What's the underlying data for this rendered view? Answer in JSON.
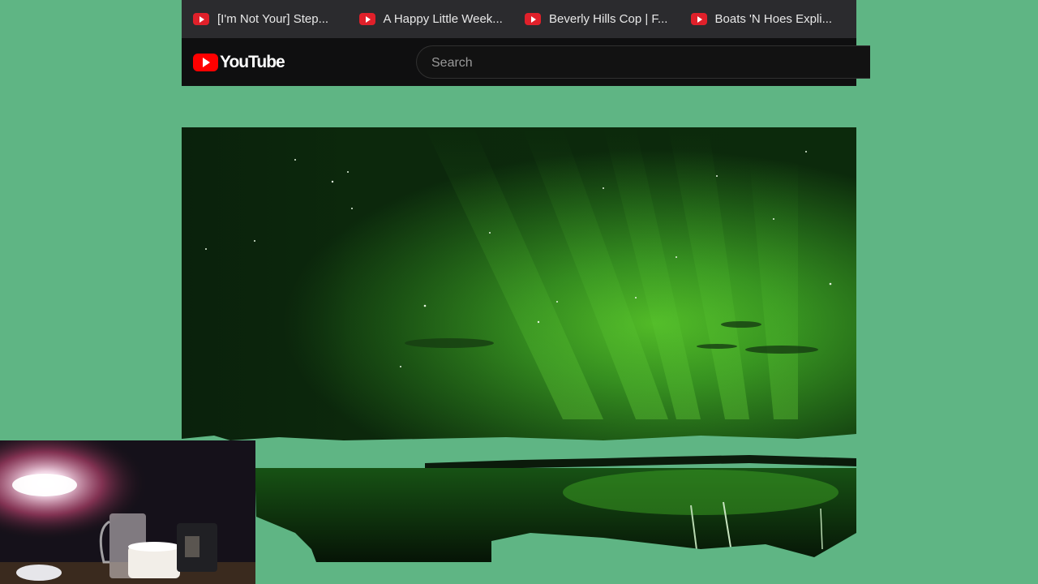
{
  "bookmarks": [
    {
      "label": "[I'm Not Your] Step...",
      "icon": "youtube-favicon-icon"
    },
    {
      "label": "A Happy Little Week...",
      "icon": "youtube-favicon-icon"
    },
    {
      "label": "Beverly Hills Cop | F...",
      "icon": "youtube-favicon-icon"
    },
    {
      "label": "Boats 'N Hoes Expli...",
      "icon": "youtube-favicon-icon"
    }
  ],
  "header": {
    "logo_text": "YouTube",
    "search": {
      "placeholder": "Search",
      "value": ""
    }
  },
  "colors": {
    "chroma_background": "#5fb584",
    "bookmark_bar": "#2b2b2e",
    "header_background": "#0f0f10",
    "brand_red": "#ff0000",
    "aurora_green": "#4fc123"
  },
  "video": {
    "content": "aurora-borealis-over-lake"
  },
  "webcam": {
    "content": "streamer-webcam-desk"
  }
}
